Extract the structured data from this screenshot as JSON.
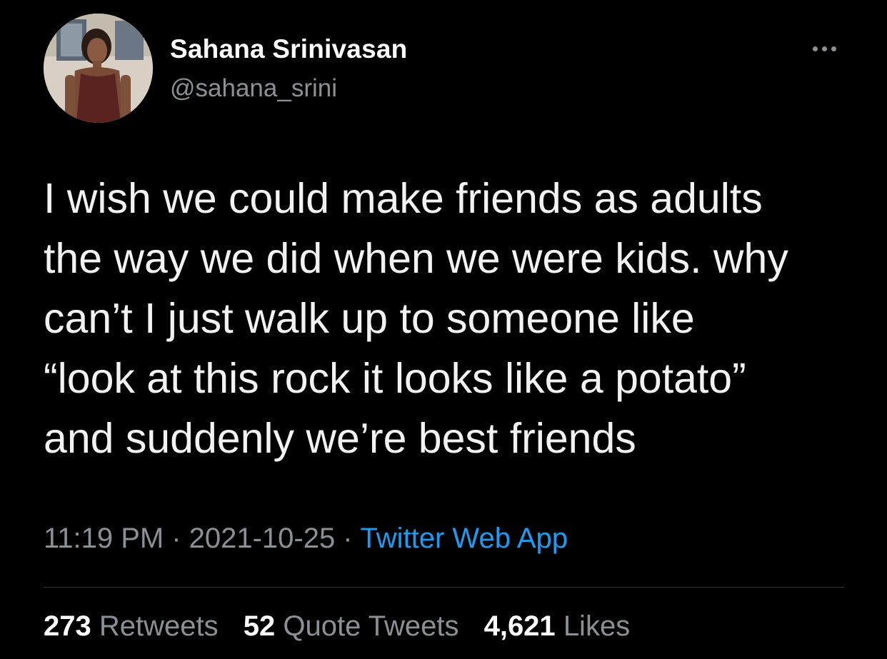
{
  "author": {
    "display_name": "Sahana Srinivasan",
    "handle": "@sahana_srini",
    "avatar_icon": "profile-photo"
  },
  "menu": {
    "more_icon": "more-dots-icon"
  },
  "tweet": {
    "lines": [
      "I wish we could make friends as adults",
      "the way we did when we were kids. why",
      "can’t I just walk up to someone like",
      "“look at this rock it looks like a potato”",
      "and suddenly we’re best friends"
    ]
  },
  "meta": {
    "time": "11:19 PM",
    "separator": "·",
    "date": "2021-10-25",
    "source": "Twitter Web App"
  },
  "stats": {
    "retweets_count": "273",
    "retweets_label": "Retweets",
    "quotes_count": "52",
    "quotes_label": "Quote Tweets",
    "likes_count": "4,621",
    "likes_label": "Likes"
  },
  "colors": {
    "background": "#000000",
    "text": "#e7e9ea",
    "secondary": "#8b9096",
    "link": "#1d9bf0",
    "divider": "#2f3336"
  }
}
